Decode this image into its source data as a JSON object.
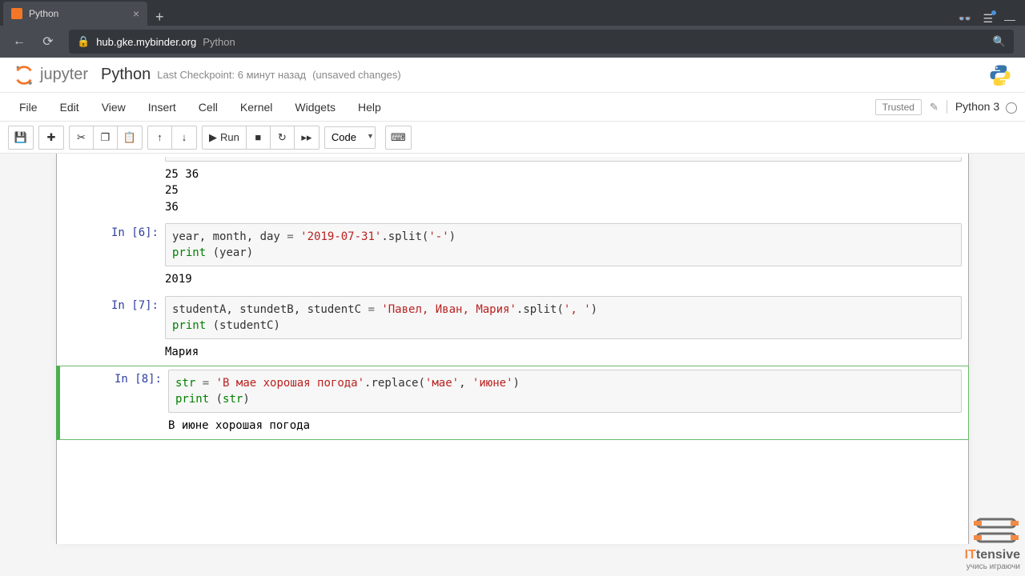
{
  "browser": {
    "tab_title": "Python",
    "url_host": "hub.gke.mybinder.org",
    "url_path": "Python"
  },
  "header": {
    "logo_text": "jupyter",
    "notebook_name": "Python",
    "checkpoint": "Last Checkpoint: 6 минут назад",
    "unsaved": "(unsaved changes)"
  },
  "menu": {
    "items": [
      "File",
      "Edit",
      "View",
      "Insert",
      "Cell",
      "Kernel",
      "Widgets",
      "Help"
    ],
    "trusted": "Trusted",
    "kernel": "Python 3"
  },
  "toolbar": {
    "run_label": "Run",
    "cell_type": "Code"
  },
  "cells": [
    {
      "prompt": "",
      "output": "25 36\n25\n36"
    },
    {
      "prompt": "In [6]:",
      "code_lines": [
        [
          {
            "t": "year, month, day ",
            "c": "s-name"
          },
          {
            "t": "=",
            "c": "s-op"
          },
          {
            "t": " ",
            "c": ""
          },
          {
            "t": "'2019-07-31'",
            "c": "s-str"
          },
          {
            "t": ".split(",
            "c": "s-name"
          },
          {
            "t": "'-'",
            "c": "s-str"
          },
          {
            "t": ")",
            "c": "s-name"
          }
        ],
        [
          {
            "t": "print",
            "c": "s-builtin"
          },
          {
            "t": " (",
            "c": "s-name"
          },
          {
            "t": "year",
            "c": "s-name"
          },
          {
            "t": ")",
            "c": "s-name"
          }
        ]
      ],
      "output": "2019"
    },
    {
      "prompt": "In [7]:",
      "code_lines": [
        [
          {
            "t": "studentA, stundetB, studentC ",
            "c": "s-name"
          },
          {
            "t": "=",
            "c": "s-op"
          },
          {
            "t": " ",
            "c": ""
          },
          {
            "t": "'Павел, Иван, Мария'",
            "c": "s-str"
          },
          {
            "t": ".split(",
            "c": "s-name"
          },
          {
            "t": "', '",
            "c": "s-str"
          },
          {
            "t": ")",
            "c": "s-name"
          }
        ],
        [
          {
            "t": "print",
            "c": "s-builtin"
          },
          {
            "t": " (",
            "c": "s-name"
          },
          {
            "t": "studentC",
            "c": "s-name"
          },
          {
            "t": ")",
            "c": "s-name"
          }
        ]
      ],
      "output": "Мария"
    },
    {
      "prompt": "In [8]:",
      "active": true,
      "code_lines": [
        [
          {
            "t": "str",
            "c": "s-builtin"
          },
          {
            "t": " ",
            "c": ""
          },
          {
            "t": "=",
            "c": "s-op"
          },
          {
            "t": " ",
            "c": ""
          },
          {
            "t": "'В мае хорошая погода'",
            "c": "s-str"
          },
          {
            "t": ".replace(",
            "c": "s-name"
          },
          {
            "t": "'мае'",
            "c": "s-str"
          },
          {
            "t": ", ",
            "c": "s-name"
          },
          {
            "t": "'июне'",
            "c": "s-str"
          },
          {
            "t": ")",
            "c": "s-name"
          }
        ],
        [
          {
            "t": "print",
            "c": "s-builtin"
          },
          {
            "t": " (",
            "c": "s-name"
          },
          {
            "t": "str",
            "c": "s-builtin"
          },
          {
            "t": ")",
            "c": "s-name"
          }
        ]
      ],
      "output": "В июне хорошая погода"
    }
  ],
  "watermark": {
    "brand1": "IT",
    "brand2": "tensive",
    "tagline": "учись играючи"
  }
}
